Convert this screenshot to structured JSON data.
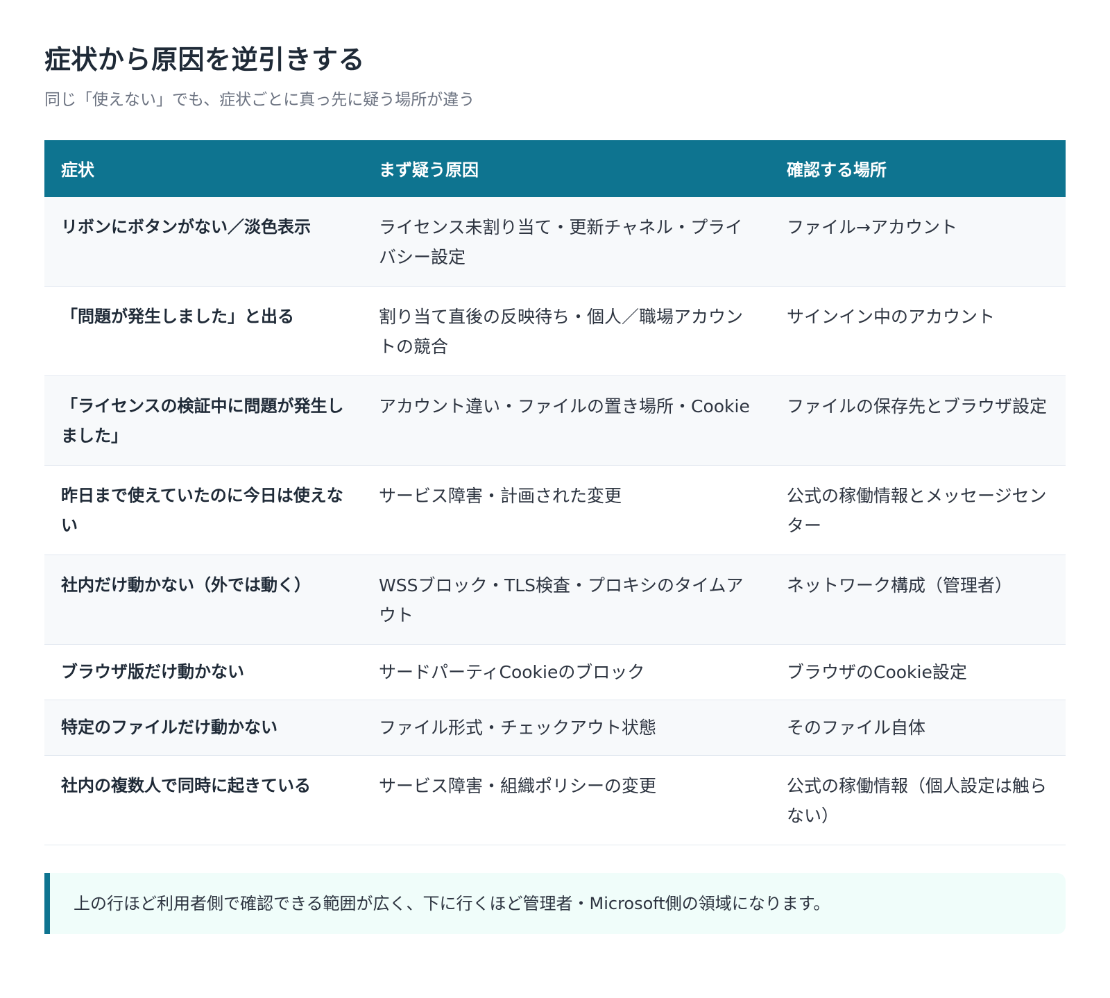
{
  "title": "症状から原因を逆引きする",
  "subtitle": "同じ「使えない」でも、症状ごとに真っ先に疑う場所が違う",
  "table": {
    "headers": [
      "症状",
      "まず疑う原因",
      "確認する場所"
    ],
    "rows": [
      [
        "リボンにボタンがない／淡色表示",
        "ライセンス未割り当て・更新チャネル・プライバシー設定",
        "ファイル→アカウント"
      ],
      [
        "「問題が発生しました」と出る",
        "割り当て直後の反映待ち・個人／職場アカウントの競合",
        "サインイン中のアカウント"
      ],
      [
        "「ライセンスの検証中に問題が発生しました」",
        "アカウント違い・ファイルの置き場所・Cookie",
        "ファイルの保存先とブラウザ設定"
      ],
      [
        "昨日まで使えていたのに今日は使えない",
        "サービス障害・計画された変更",
        "公式の稼働情報とメッセージセンター"
      ],
      [
        "社内だけ動かない（外では動く）",
        "WSSブロック・TLS検査・プロキシのタイムアウト",
        "ネットワーク構成（管理者）"
      ],
      [
        "ブラウザ版だけ動かない",
        "サードパーティCookieのブロック",
        "ブラウザのCookie設定"
      ],
      [
        "特定のファイルだけ動かない",
        "ファイル形式・チェックアウト状態",
        "そのファイル自体"
      ],
      [
        "社内の複数人で同時に起きている",
        "サービス障害・組織ポリシーの変更",
        "公式の稼働情報（個人設定は触らない）"
      ]
    ]
  },
  "note": "上の行ほど利用者側で確認できる範囲が広く、下に行くほど管理者・Microsoft側の領域になります。",
  "colors": {
    "header_bg": "#0e7490",
    "note_bg": "#f0fdfa",
    "accent": "#0e7490"
  }
}
